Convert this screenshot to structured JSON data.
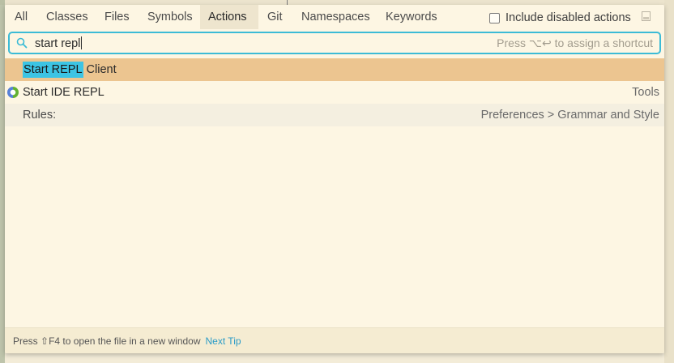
{
  "tabs": [
    {
      "label": "All"
    },
    {
      "label": "Classes"
    },
    {
      "label": "Files"
    },
    {
      "label": "Symbols"
    },
    {
      "label": "Actions"
    },
    {
      "label": "Git"
    },
    {
      "label": "Namespaces"
    },
    {
      "label": "Keywords"
    }
  ],
  "active_tab": "Actions",
  "include_disabled": {
    "label": "Include disabled actions",
    "checked": false
  },
  "search": {
    "value": "start repl",
    "hint": "Press ⌥↩ to assign a shortcut"
  },
  "results": [
    {
      "match": "Start REPL",
      "rest": " Client",
      "category": ""
    },
    {
      "title": "Start IDE REPL",
      "category": "Tools",
      "icon": "clojure-icon"
    },
    {
      "title": "Rules:",
      "category": "Preferences > Grammar and Style"
    }
  ],
  "footer": {
    "tip": "Press ⇧F4 to open the file in a new window",
    "next_tip": "Next Tip"
  },
  "colors": {
    "accent": "#3cbbd6",
    "selection": "#ecc590",
    "highlight": "#3cc4e4",
    "background": "#fdf6e3"
  }
}
